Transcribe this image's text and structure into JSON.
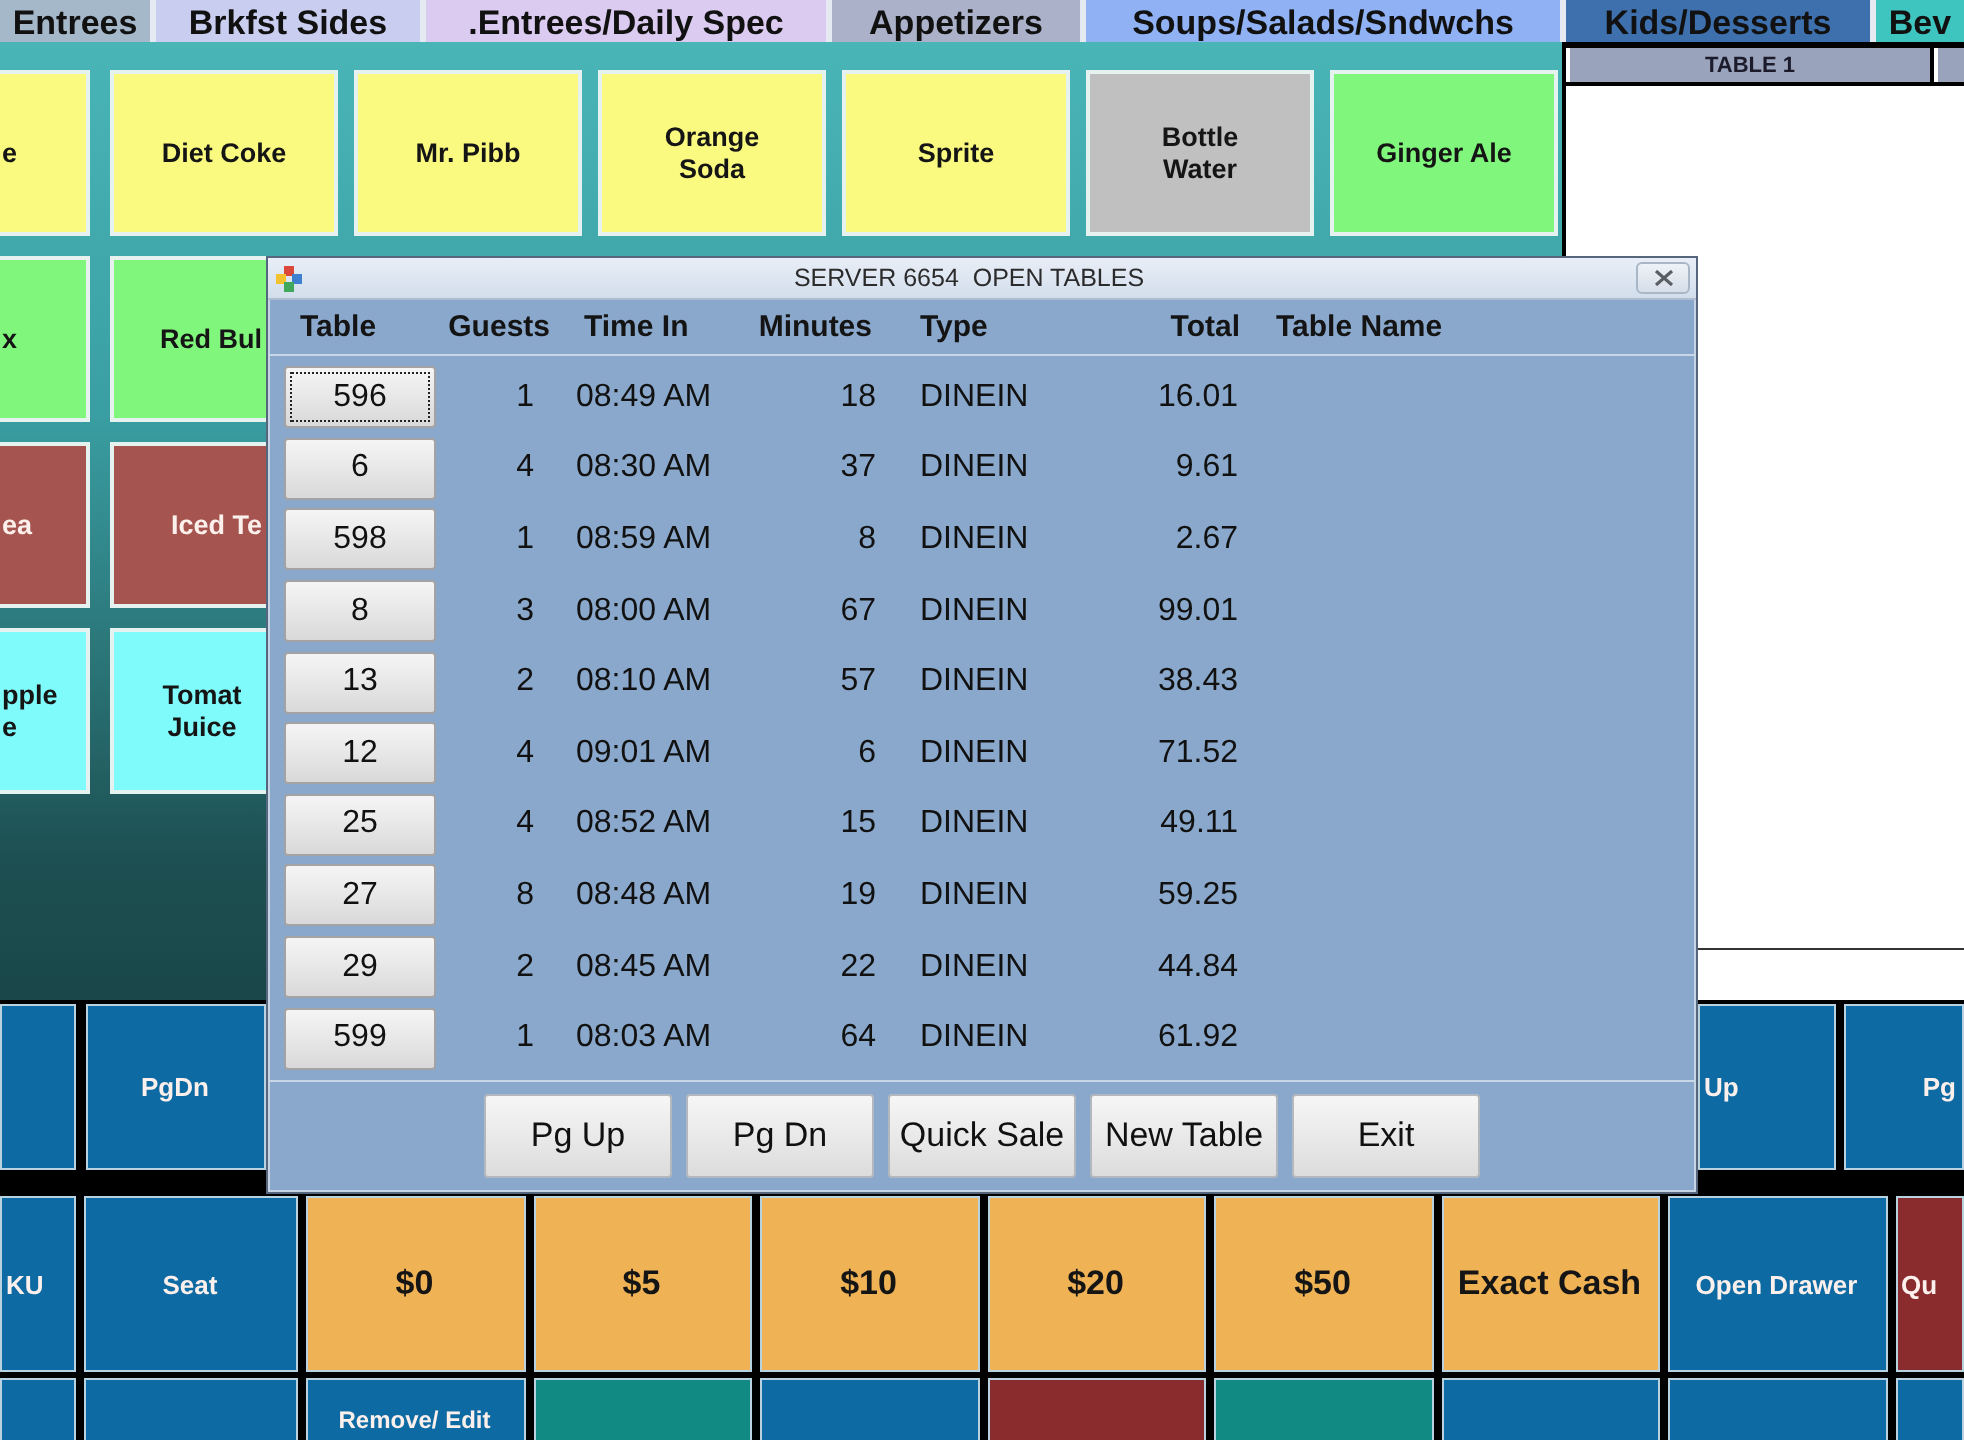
{
  "category_tabs": [
    {
      "label": "Entrees",
      "color": "#a5b8c9"
    },
    {
      "label": "Brkfst Sides",
      "color": "#c9cef0"
    },
    {
      "label": ".Entrees/Daily Spec",
      "color": "#dccbf0"
    },
    {
      "label": "Appetizers",
      "color": "#aab1c8"
    },
    {
      "label": "Soups/Salads/Sndwchs",
      "color": "#90b2f5"
    },
    {
      "label": "Kids/Desserts",
      "color": "#3f70ae"
    },
    {
      "label": "Bev",
      "color": "#3fc5bf"
    }
  ],
  "menu_grid": [
    {
      "items": [
        {
          "label": "e",
          "color": "#fafa80"
        },
        {
          "label": "Diet Coke",
          "color": "#fafa80"
        },
        {
          "label": "Mr. Pibb",
          "color": "#fafa80"
        },
        {
          "label": "Orange Soda",
          "color": "#fafa80"
        },
        {
          "label": "Sprite",
          "color": "#fafa80"
        },
        {
          "label": "Bottle Water",
          "color": "#c0c0c0"
        },
        {
          "label": "Ginger Ale",
          "color": "#80f77c"
        }
      ]
    },
    {
      "items": [
        {
          "label": "x",
          "color": "#80f77c"
        },
        {
          "label": "Red Bul",
          "color": "#80f77c"
        }
      ]
    },
    {
      "items": [
        {
          "label": "ea",
          "color": "#a5544f"
        },
        {
          "label": "Iced Te",
          "color": "#a5544f"
        }
      ]
    },
    {
      "items": [
        {
          "label": "pple e",
          "color": "#80fbfb"
        },
        {
          "label": "Tomat Juice",
          "color": "#80fbfb"
        }
      ]
    }
  ],
  "order_panel": {
    "header": "TABLE 1"
  },
  "function_keys": {
    "top_row": {
      "left": [
        {
          "color": "#0e6aa2"
        },
        {
          "label": "PgDn",
          "color": "#0e6aa2"
        }
      ],
      "right": [
        {
          "label": "Up",
          "color": "#0e6aa2"
        },
        {
          "label": "Pg",
          "color": "#0e6aa2"
        }
      ]
    },
    "middle_row": [
      {
        "label": "KU",
        "color": "#0e6aa2"
      },
      {
        "label": "Seat",
        "color": "#0e6aa2"
      },
      {
        "label": "$0",
        "color": "#efb255"
      },
      {
        "label": "$5",
        "color": "#efb255"
      },
      {
        "label": "$10",
        "color": "#efb255"
      },
      {
        "label": "$20",
        "color": "#efb255"
      },
      {
        "label": "$50",
        "color": "#efb255"
      },
      {
        "label": "Exact Cash",
        "color": "#efb255"
      },
      {
        "label": "Open Drawer",
        "color": "#0e6aa2"
      },
      {
        "label": "Qu",
        "color": "#8a2b2d"
      }
    ],
    "bottom_row": [
      {
        "color": "#0e6aa2"
      },
      {
        "color": "#0e6aa2"
      },
      {
        "label": "Remove/ Edit",
        "color": "#0e6aa2"
      },
      {
        "color": "#128a84"
      },
      {
        "color": "#0e6aa2"
      },
      {
        "color": "#8a2b2d"
      },
      {
        "color": "#128a84"
      },
      {
        "color": "#0e6aa2"
      },
      {
        "color": "#0e6aa2"
      },
      {
        "color": "#0e6aa2"
      }
    ]
  },
  "dialog": {
    "title": "SERVER 6654  OPEN TABLES",
    "columns": [
      "Table",
      "Guests",
      "Time In",
      "Minutes",
      "Type",
      "Total",
      "Table Name"
    ],
    "rows": [
      {
        "table": "596",
        "guests": "1",
        "time_in": "08:49 AM",
        "minutes": "18",
        "type": "DINEIN",
        "total": "16.01",
        "focused": true
      },
      {
        "table": "6",
        "guests": "4",
        "time_in": "08:30 AM",
        "minutes": "37",
        "type": "DINEIN",
        "total": "9.61",
        "focused": false
      },
      {
        "table": "598",
        "guests": "1",
        "time_in": "08:59 AM",
        "minutes": "8",
        "type": "DINEIN",
        "total": "2.67",
        "focused": false
      },
      {
        "table": "8",
        "guests": "3",
        "time_in": "08:00 AM",
        "minutes": "67",
        "type": "DINEIN",
        "total": "99.01",
        "focused": false
      },
      {
        "table": "13",
        "guests": "2",
        "time_in": "08:10 AM",
        "minutes": "57",
        "type": "DINEIN",
        "total": "38.43",
        "focused": false
      },
      {
        "table": "12",
        "guests": "4",
        "time_in": "09:01 AM",
        "minutes": "6",
        "type": "DINEIN",
        "total": "71.52",
        "focused": false
      },
      {
        "table": "25",
        "guests": "4",
        "time_in": "08:52 AM",
        "minutes": "15",
        "type": "DINEIN",
        "total": "49.11",
        "focused": false
      },
      {
        "table": "27",
        "guests": "8",
        "time_in": "08:48 AM",
        "minutes": "19",
        "type": "DINEIN",
        "total": "59.25",
        "focused": false
      },
      {
        "table": "29",
        "guests": "2",
        "time_in": "08:45 AM",
        "minutes": "22",
        "type": "DINEIN",
        "total": "44.84",
        "focused": false
      },
      {
        "table": "599",
        "guests": "1",
        "time_in": "08:03 AM",
        "minutes": "64",
        "type": "DINEIN",
        "total": "61.92",
        "focused": false
      }
    ],
    "buttons": [
      "Pg Up",
      "Pg Dn",
      "Quick Sale",
      "New Table",
      "Exit"
    ]
  }
}
